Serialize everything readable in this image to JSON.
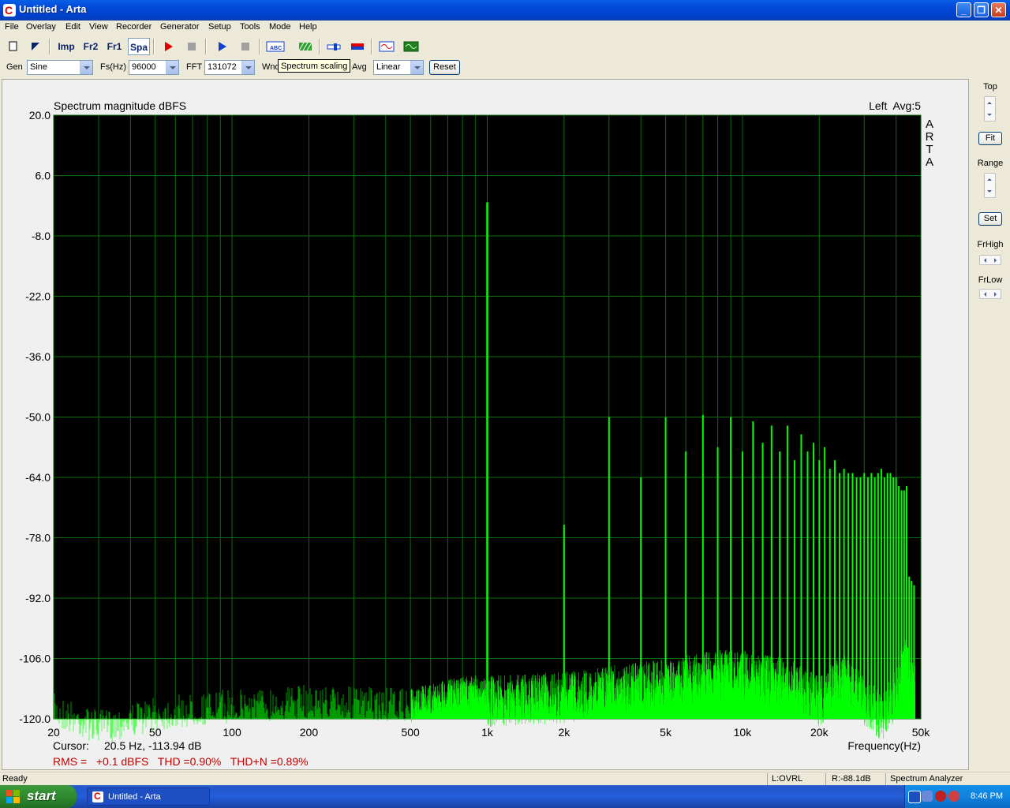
{
  "window": {
    "title": "Untitled - Arta"
  },
  "menu": [
    "File",
    "Overlay",
    "Edit",
    "View",
    "Recorder",
    "Generator",
    "Setup",
    "Tools",
    "Mode",
    "Help"
  ],
  "toolbar": {
    "imp": "Imp",
    "fr2": "Fr2",
    "fr1": "Fr1",
    "spa": "Spa"
  },
  "controls": {
    "gen_label": "Gen",
    "gen_value": "Sine",
    "fs_label": "Fs(Hz)",
    "fs_value": "96000",
    "fft_label": "FFT",
    "fft_value": "131072",
    "wnd_label": "Wnd",
    "avg_label": "Avg",
    "avg_value": "Linear",
    "reset_label": "Reset",
    "tooltip": "Spectrum scaling"
  },
  "right_panel": {
    "top_label": "Top",
    "fit_label": "Fit",
    "range_label": "Range",
    "set_label": "Set",
    "frhigh_label": "FrHigh",
    "frlow_label": "FrLow"
  },
  "chart_data": {
    "type": "line",
    "title": "Spectrum magnitude dBFS",
    "channel_info": "Left  Avg:5",
    "watermark": "ARTA",
    "xlabel": "Frequency(Hz)",
    "x_scale": "log",
    "xlim": [
      20,
      50000
    ],
    "ylim": [
      -120,
      20
    ],
    "yticks": [
      20,
      6,
      -8,
      -22,
      -36,
      -50,
      -64,
      -78,
      -92,
      -106,
      -120
    ],
    "ytick_labels": [
      "20.0",
      "6.0",
      "-8.0",
      "-22.0",
      "-36.0",
      "-50.0",
      "-64.0",
      "-78.0",
      "-92.0",
      "-106.0",
      "-120.0"
    ],
    "xticks": [
      20,
      50,
      100,
      200,
      500,
      1000,
      2000,
      5000,
      10000,
      20000,
      50000
    ],
    "xtick_labels": [
      "20",
      "50",
      "100",
      "200",
      "500",
      "1k",
      "2k",
      "5k",
      "10k",
      "20k",
      "50k"
    ],
    "grid": true,
    "colors": {
      "background": "#000000",
      "grid": "#0a6e0a",
      "trace": "#00ff00"
    },
    "harmonics": [
      {
        "f": 1000,
        "db": -0.2
      },
      {
        "f": 2000,
        "db": -75
      },
      {
        "f": 3000,
        "db": -50
      },
      {
        "f": 4000,
        "db": -64
      },
      {
        "f": 5000,
        "db": -50
      },
      {
        "f": 6000,
        "db": -58
      },
      {
        "f": 7000,
        "db": -49.5
      },
      {
        "f": 8000,
        "db": -57
      },
      {
        "f": 9000,
        "db": -50
      },
      {
        "f": 10000,
        "db": -58
      },
      {
        "f": 11000,
        "db": -51
      },
      {
        "f": 12000,
        "db": -56
      },
      {
        "f": 13000,
        "db": -52
      },
      {
        "f": 14000,
        "db": -58
      },
      {
        "f": 15000,
        "db": -52
      },
      {
        "f": 16000,
        "db": -60
      },
      {
        "f": 17000,
        "db": -54
      },
      {
        "f": 18000,
        "db": -58
      },
      {
        "f": 19000,
        "db": -56
      },
      {
        "f": 20000,
        "db": -60
      },
      {
        "f": 21000,
        "db": -57
      },
      {
        "f": 22000,
        "db": -62
      },
      {
        "f": 23000,
        "db": -60
      },
      {
        "f": 24000,
        "db": -63
      },
      {
        "f": 25000,
        "db": -62
      },
      {
        "f": 26000,
        "db": -63
      },
      {
        "f": 27000,
        "db": -63
      },
      {
        "f": 28000,
        "db": -64
      },
      {
        "f": 29000,
        "db": -64
      },
      {
        "f": 30000,
        "db": -63
      },
      {
        "f": 31000,
        "db": -64
      },
      {
        "f": 32000,
        "db": -63
      },
      {
        "f": 33000,
        "db": -64
      },
      {
        "f": 34000,
        "db": -63
      },
      {
        "f": 35000,
        "db": -62
      },
      {
        "f": 36000,
        "db": -64
      },
      {
        "f": 37000,
        "db": -63
      },
      {
        "f": 38000,
        "db": -63
      },
      {
        "f": 39000,
        "db": -64
      },
      {
        "f": 40000,
        "db": -64
      },
      {
        "f": 41000,
        "db": -66
      },
      {
        "f": 42000,
        "db": -67
      },
      {
        "f": 43000,
        "db": -67
      },
      {
        "f": 44000,
        "db": -66
      },
      {
        "f": 45000,
        "db": -87
      },
      {
        "f": 46000,
        "db": -88
      },
      {
        "f": 47000,
        "db": -89
      }
    ],
    "noise_floor": [
      {
        "f": 20,
        "db": -114
      },
      {
        "f": 30,
        "db": -118
      },
      {
        "f": 50,
        "db": -115
      },
      {
        "f": 100,
        "db": -113
      },
      {
        "f": 200,
        "db": -112
      },
      {
        "f": 500,
        "db": -113
      },
      {
        "f": 800,
        "db": -110
      },
      {
        "f": 1000,
        "db": -110
      },
      {
        "f": 2000,
        "db": -109
      },
      {
        "f": 5000,
        "db": -106
      },
      {
        "f": 8000,
        "db": -104
      },
      {
        "f": 10000,
        "db": -104
      },
      {
        "f": 15000,
        "db": -106
      },
      {
        "f": 20000,
        "db": -110
      },
      {
        "f": 25000,
        "db": -104
      },
      {
        "f": 30000,
        "db": -110
      },
      {
        "f": 35000,
        "db": -114
      },
      {
        "f": 40000,
        "db": -108
      },
      {
        "f": 43000,
        "db": -100
      },
      {
        "f": 46000,
        "db": -106
      }
    ]
  },
  "readouts": {
    "cursor_label": "Cursor:",
    "cursor_value": "20.5 Hz, -113.94 dB",
    "rms": "RMS =   +0.1 dBFS   THD =0.90%   THD+N =0.89%"
  },
  "status": {
    "ready": "Ready",
    "ovrl": "L:OVRL",
    "r_level": "R:-88.1dB",
    "mode": "Spectrum Analyzer"
  },
  "taskbar": {
    "start": "start",
    "task": "Untitled - Arta",
    "clock": "8:46 PM"
  }
}
